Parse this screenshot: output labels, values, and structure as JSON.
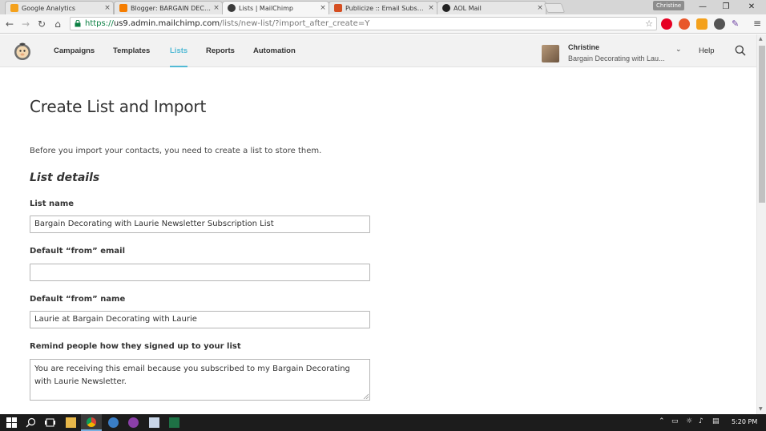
{
  "browser": {
    "tabs": [
      {
        "title": "Google Analytics",
        "favicon_color": "#f4a11c"
      },
      {
        "title": "Blogger: BARGAIN DECOR",
        "favicon_color": "#f57d00"
      },
      {
        "title": "Lists | MailChimp",
        "favicon_color": "#3b3b3b"
      },
      {
        "title": "Publicize :: Email Subscripti",
        "favicon_color": "#d54e21"
      },
      {
        "title": "AOL Mail",
        "favicon_color": "#222222"
      }
    ],
    "active_tab": 2,
    "profile_name": "Christine",
    "url_scheme": "https://",
    "url_host": "us9.admin.mailchimp.com",
    "url_path": "/lists/new-list/?import_after_create=Y",
    "close_glyph": "×"
  },
  "mailchimp": {
    "nav": [
      {
        "label": "Campaigns"
      },
      {
        "label": "Templates"
      },
      {
        "label": "Lists",
        "active": true
      },
      {
        "label": "Reports"
      },
      {
        "label": "Automation"
      }
    ],
    "user": {
      "name": "Christine",
      "org": "Bargain Decorating with Lau..."
    },
    "help_label": "Help",
    "accent": "#52bad5"
  },
  "form": {
    "page_title": "Create List and Import",
    "intro": "Before you import your contacts, you need to create a list to store them.",
    "section_title": "List details",
    "list_name_label": "List name",
    "list_name_value": "Bargain Decorating with Laurie Newsletter Subscription List",
    "from_email_label": "Default “from” email",
    "from_email_value": "",
    "from_name_label": "Default “from” name",
    "from_name_value": "Laurie at Bargain Decorating with Laurie",
    "remind_label": "Remind people how they signed up to your list",
    "remind_value": "You are receiving this email because you subscribed to my Bargain Decorating with Laurie Newsletter."
  },
  "taskbar": {
    "clock": "5:20 PM"
  }
}
